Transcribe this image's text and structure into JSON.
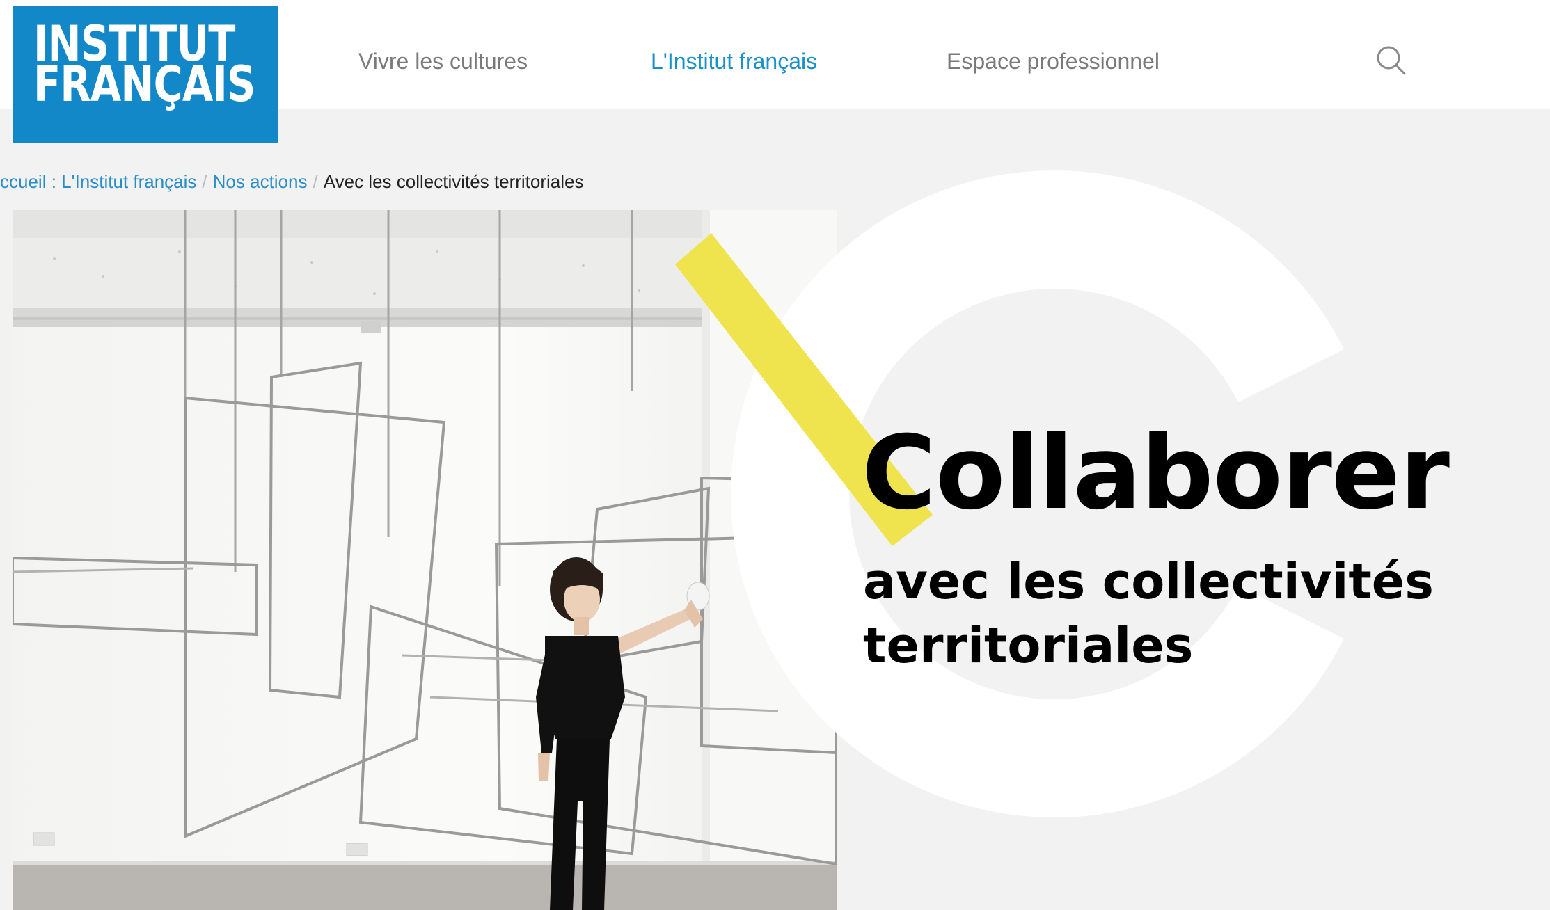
{
  "header": {
    "logo": {
      "line1": "INSTITUT",
      "line2": "FRANÇAIS"
    },
    "nav": [
      {
        "label": "Vivre les cultures",
        "active": false
      },
      {
        "label": "L'Institut français",
        "active": true
      },
      {
        "label": "Espace professionnel",
        "active": false
      }
    ],
    "search_icon": "search-icon"
  },
  "breadcrumb": {
    "items": [
      {
        "label": "ccueil : L'Institut français"
      },
      {
        "label": "Nos actions"
      }
    ],
    "separator": "/",
    "current": "Avec les collectivités territoriales"
  },
  "hero": {
    "title": "Collaborer",
    "subtitle": "avec les collectivités territoriales"
  },
  "colors": {
    "brand_blue": "#1288c8",
    "link_blue": "#2b8dc7",
    "accent_yellow": "#f0e44e",
    "background": "#f2f2f2"
  }
}
